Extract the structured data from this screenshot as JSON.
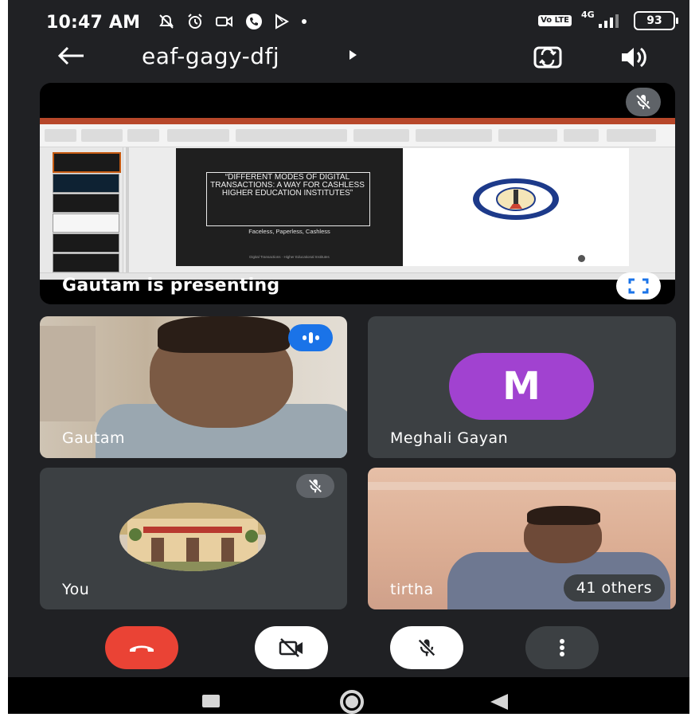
{
  "status_bar": {
    "time": "10:47 AM",
    "network": "4G",
    "volte": "Vo LTE",
    "battery": "93"
  },
  "app_bar": {
    "meeting_code": "eaf-gagy-dfj"
  },
  "presentation": {
    "presenting_text": "Gautam is presenting",
    "slide_title": "“DIFFERENT MODES OF DIGITAL TRANSACTIONS: A WAY FOR CASHLESS HIGHER EDUCATION INSTITUTES”",
    "slide_subtitle": "Faceless, Paperless, Cashless"
  },
  "participants": [
    {
      "name": "Gautam",
      "speaking": true
    },
    {
      "name": "Meghali Gayan",
      "initial": "M",
      "avatar_color": "#a142d0"
    },
    {
      "name": "You",
      "muted": true
    },
    {
      "name": "tirtha"
    }
  ],
  "others_badge": "41 others",
  "controls": [
    "end-call",
    "camera-off",
    "mic-off",
    "more-options"
  ],
  "colors": {
    "background": "#202124",
    "end_call": "#ea4335",
    "speaking": "#1a73e8",
    "avatar": "#a142d0"
  }
}
